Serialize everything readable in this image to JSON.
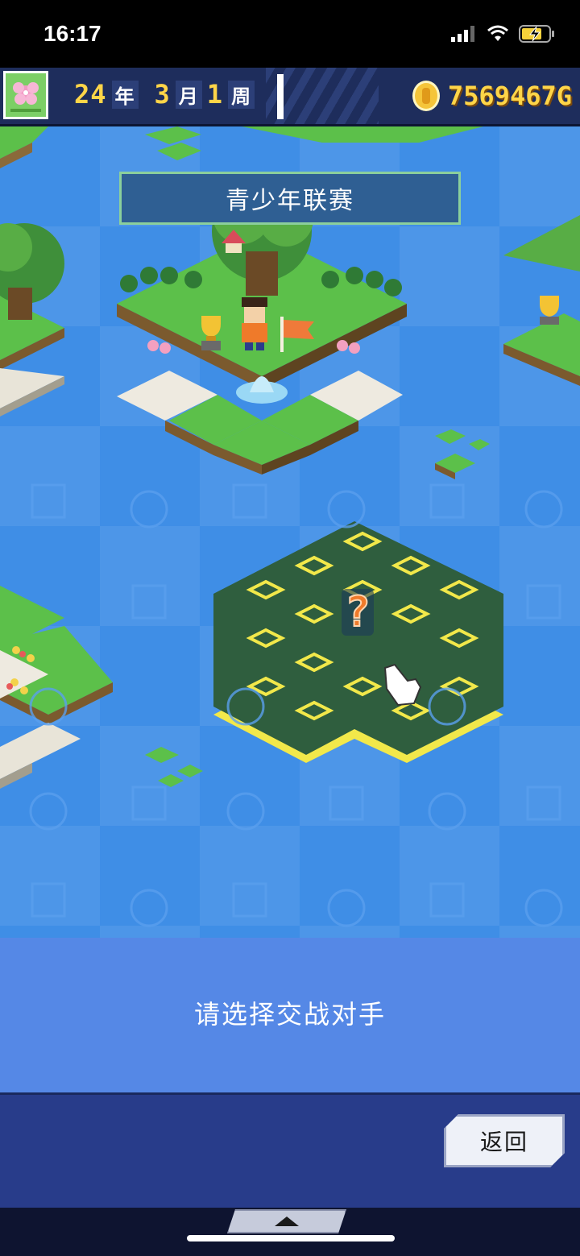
{
  "status_bar": {
    "time": "16:17"
  },
  "hud": {
    "year_value": "24",
    "year_unit": "年",
    "month_value": "3",
    "month_unit": "月",
    "week_value": "1",
    "week_unit": "周",
    "money": "7569467G"
  },
  "map": {
    "title": "青少年联赛",
    "marker": "?"
  },
  "prompt": {
    "text": "请选择交战对手"
  },
  "buttons": {
    "back": "返回"
  },
  "colors": {
    "water": "#3f8ee6",
    "grass": "#5cc04a",
    "dark_tile": "#2f5e3e",
    "accent_yellow": "#f2e84a",
    "panel": "#5588e6",
    "bottom_bar": "#283c8a"
  }
}
